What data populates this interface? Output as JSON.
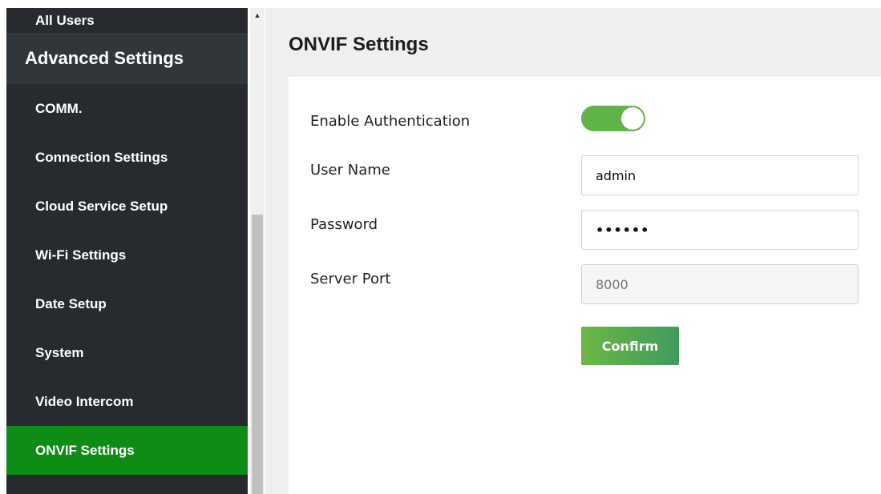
{
  "sidebar": {
    "items_top": [
      {
        "label": "All Users"
      }
    ],
    "group_label": "Advanced Settings",
    "items": [
      {
        "label": "COMM."
      },
      {
        "label": "Connection Settings"
      },
      {
        "label": "Cloud Service Setup"
      },
      {
        "label": "Wi-Fi Settings"
      },
      {
        "label": "Date Setup"
      },
      {
        "label": "System"
      },
      {
        "label": "Video Intercom"
      },
      {
        "label": "ONVIF Settings",
        "active": true
      }
    ]
  },
  "scrollbar": {
    "up_icon": "triangle-up-icon"
  },
  "main": {
    "title": "ONVIF Settings",
    "form": {
      "enable_auth": {
        "label": "Enable Authentication",
        "enabled": true
      },
      "username": {
        "label": "User Name",
        "value": "admin"
      },
      "password": {
        "label": "Password",
        "value": "••••••"
      },
      "server_port": {
        "label": "Server Port",
        "value": "8000"
      },
      "confirm_label": "Confirm"
    }
  },
  "colors": {
    "sidebar_bg": "#272b2f",
    "active_item": "#0e8c15",
    "toggle_on": "#5fb347",
    "confirm_start": "#6cb745",
    "confirm_end": "#3f9a5e"
  }
}
